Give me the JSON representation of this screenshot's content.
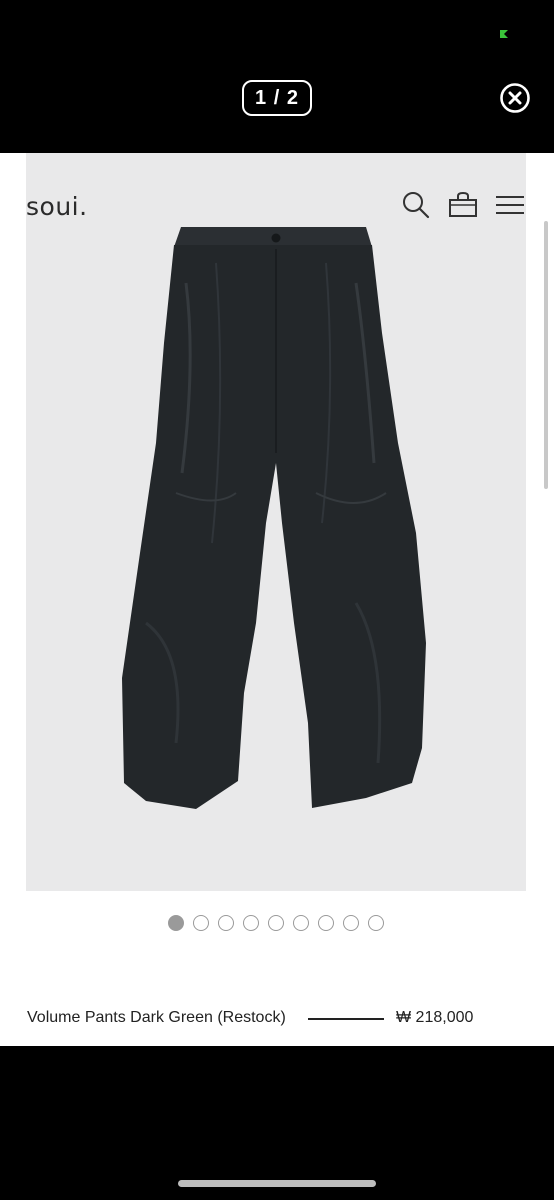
{
  "status": {
    "indicator_icon": "green-status-icon",
    "indicator_color": "#3ac43a"
  },
  "header": {
    "counter": "1 / 2",
    "close_icon": "close-circle-icon"
  },
  "site": {
    "logo": "soui.",
    "icons": [
      "search-icon",
      "shopping-bag-icon",
      "hamburger-menu-icon"
    ]
  },
  "product": {
    "image": "dark-green-volume-pants-photo",
    "name": "Volume Pants Dark Green (Restock)",
    "price": "₩ 218,000"
  },
  "carousel": {
    "total_slides": 9,
    "active_slide": 1
  },
  "colors": {
    "background": "#000000",
    "photo_bg": "#e9e9ea",
    "pants": "#23272a",
    "dot": "#9a9a9a"
  }
}
